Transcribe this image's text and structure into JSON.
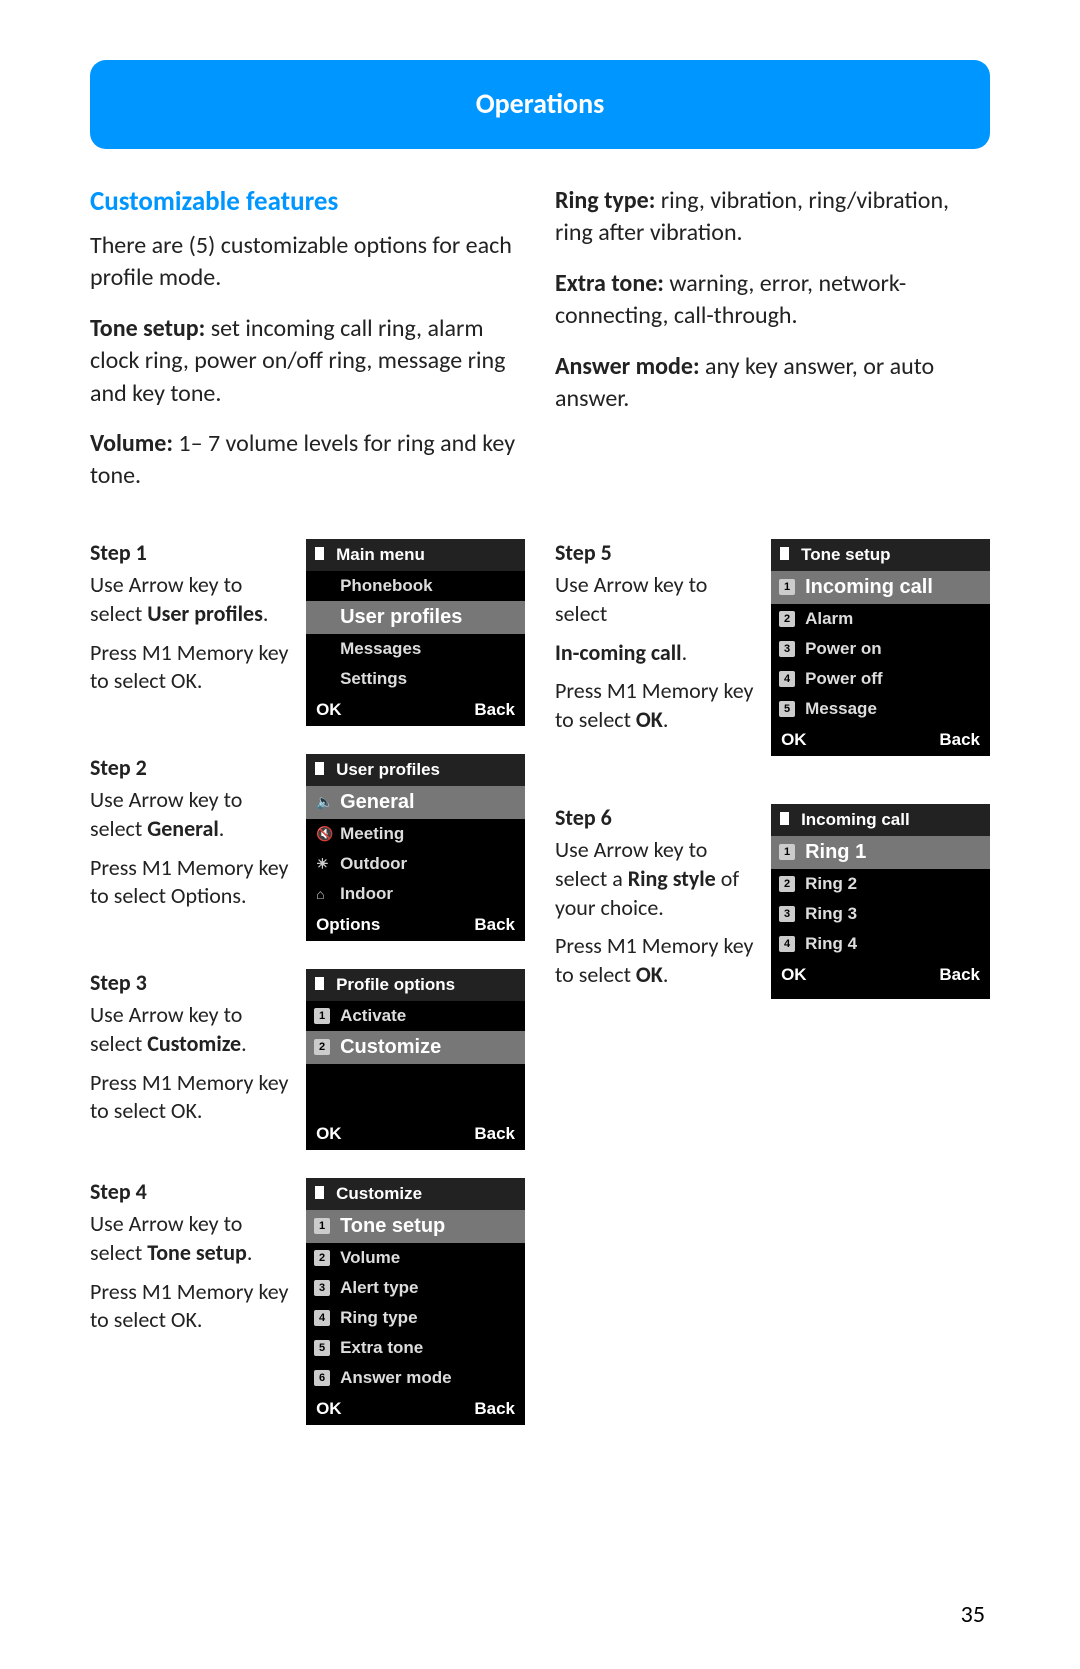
{
  "header": "Operations",
  "section_title": "Customizable features",
  "intro": "There are (5) customizable options for each profile mode.",
  "features": {
    "tone_setup_label": "Tone setup:",
    "tone_setup_text": " set incoming call ring, alarm clock ring, power on/off ring, message ring and key tone.",
    "volume_label": "Volume:",
    "volume_text": " 1– 7 volume levels for ring and key tone.",
    "ring_type_label": "Ring type:",
    "ring_type_text": " ring, vibration, ring/vibration, ring after vibration.",
    "extra_tone_label": "Extra tone:",
    "extra_tone_text": " warning, error, network-connecting, call-through.",
    "answer_mode_label": "Answer mode:",
    "answer_mode_text": " any key answer, or auto answer."
  },
  "steps": {
    "s1": {
      "label": "Step 1",
      "l1a": "Use Arrow key to select ",
      "l1b": "User profiles",
      "l1c": ".",
      "l2": "Press M1 Memory key to select OK."
    },
    "s2": {
      "label": "Step 2",
      "l1a": "Use Arrow key to select ",
      "l1b": "General",
      "l1c": ".",
      "l2": "Press M1 Memory key to select Options."
    },
    "s3": {
      "label": "Step 3",
      "l1a": "Use Arrow key to select ",
      "l1b": "Customize",
      "l1c": ".",
      "l2": "Press M1 Memory key to select OK."
    },
    "s4": {
      "label": "Step 4",
      "l1a": "Use Arrow key to select ",
      "l1b": "Tone setup",
      "l1c": ".",
      "l2": "Press M1 Memory key to select OK."
    },
    "s5": {
      "label": "Step 5",
      "l1a": "Use Arrow key to select ",
      "l1b": "In-coming  call",
      "l1c": ".",
      "l2a": "Press M1 Memory key to select ",
      "l2b": "OK",
      "l2c": "."
    },
    "s6": {
      "label": "Step 6",
      "l1a": "Use Arrow key to select a ",
      "l1b": "Ring style",
      "l1c": " of your choice.",
      "l2a": "Press M1 Memory key to select ",
      "l2b": "OK",
      "l2c": "."
    }
  },
  "screens": {
    "main_menu": {
      "title": "Main menu",
      "items": [
        "Phonebook",
        "User profiles",
        "Messages",
        "Settings"
      ],
      "sk_left": "OK",
      "sk_right": "Back"
    },
    "user_profiles": {
      "title": "User profiles",
      "items": [
        "General",
        "Meeting",
        "Outdoor",
        "Indoor"
      ],
      "sk_left": "Options",
      "sk_right": "Back"
    },
    "profile_options": {
      "title": "Profile options",
      "items": [
        "Activate",
        "Customize"
      ],
      "sk_left": "OK",
      "sk_right": "Back"
    },
    "customize": {
      "title": "Customize",
      "items": [
        "Tone setup",
        "Volume",
        "Alert type",
        "Ring type",
        "Extra tone",
        "Answer mode"
      ],
      "sk_left": "OK",
      "sk_right": "Back"
    },
    "tone_setup": {
      "title": "Tone setup",
      "items": [
        "Incoming call",
        "Alarm",
        "Power on",
        "Power off",
        "Message"
      ],
      "sk_left": "OK",
      "sk_right": "Back"
    },
    "incoming_call": {
      "title": "Incoming call",
      "items": [
        "Ring 1",
        "Ring 2",
        "Ring 3",
        "Ring 4"
      ],
      "sk_left": "OK",
      "sk_right": "Back"
    }
  },
  "page_number": "35"
}
